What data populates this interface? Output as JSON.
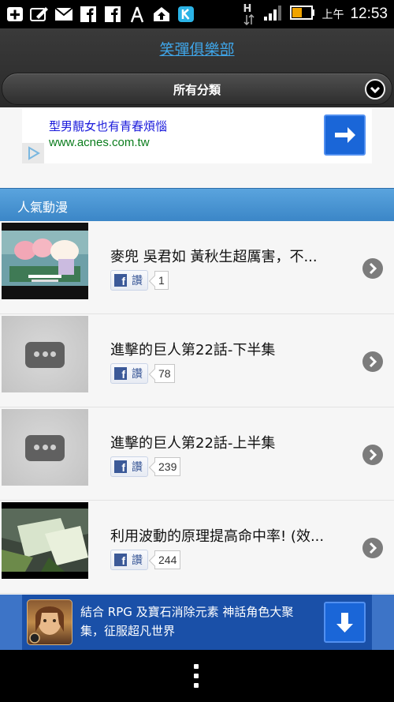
{
  "status_bar": {
    "ampm": "上午",
    "time": "12:53",
    "left_icons": [
      "plus-box-icon",
      "edit-box-icon",
      "mail-icon",
      "facebook-icon",
      "facebook-icon",
      "wifi-tower-icon",
      "upload-cloud-icon",
      "k-app-icon"
    ],
    "right_icons": [
      "h-data-icon",
      "signal-icon",
      "battery-icon"
    ]
  },
  "header": {
    "title": "笑彈俱樂部",
    "category_label": "所有分類"
  },
  "ad_top": {
    "title": "型男靚女也有青春煩惱",
    "url": "www.acnes.com.tw"
  },
  "section": {
    "label": "人氣動漫"
  },
  "items": [
    {
      "title": "麥兜 吳君如 黃秋生超厲害，不...",
      "like_label": "讚",
      "like_count": "1"
    },
    {
      "title": "進擊的巨人第22話-下半集",
      "like_label": "讚",
      "like_count": "78"
    },
    {
      "title": "進擊的巨人第22話-上半集",
      "like_label": "讚",
      "like_count": "239"
    },
    {
      "title": "利用波動的原理提高命中率! (效...",
      "like_label": "讚",
      "like_count": "244"
    }
  ],
  "ad_bottom": {
    "text": "結合 RPG 及寶石消除元素 神話角色大聚集，征服超凡世界"
  },
  "colors": {
    "accent_blue": "#3b86c7",
    "title_link": "#3fa5e8",
    "facebook": "#3b5998"
  }
}
